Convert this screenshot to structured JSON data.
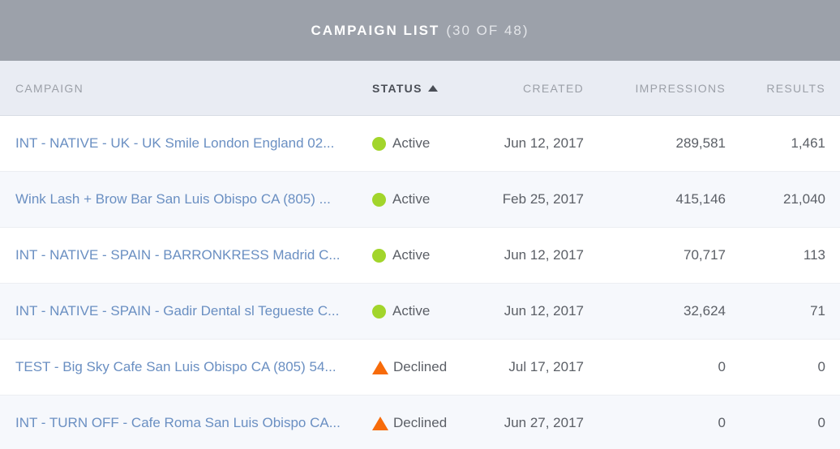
{
  "header": {
    "title": "CAMPAIGN LIST",
    "count": "(30 OF 48)"
  },
  "columns": {
    "campaign": "CAMPAIGN",
    "status": "STATUS",
    "created": "CREATED",
    "impressions": "IMPRESSIONS",
    "results": "RESULTS"
  },
  "sort": {
    "column": "STATUS",
    "direction": "ascending"
  },
  "colors": {
    "title_bar": "#9ca1aa",
    "link": "#6a8fc2",
    "active": "#a2d52b",
    "declined": "#f76b0a"
  },
  "rows": [
    {
      "campaign": "INT - NATIVE - UK - UK Smile London England 02...",
      "status": "Active",
      "status_icon": "active-dot-icon",
      "created": "Jun 12, 2017",
      "impressions": "289,581",
      "results": "1,461"
    },
    {
      "campaign": "Wink Lash + Brow Bar San Luis Obispo CA (805) ...",
      "status": "Active",
      "status_icon": "active-dot-icon",
      "created": "Feb 25, 2017",
      "impressions": "415,146",
      "results": "21,040"
    },
    {
      "campaign": "INT - NATIVE - SPAIN - BARRONKRESS Madrid C...",
      "status": "Active",
      "status_icon": "active-dot-icon",
      "created": "Jun 12, 2017",
      "impressions": "70,717",
      "results": "113"
    },
    {
      "campaign": "INT - NATIVE - SPAIN - Gadir Dental sl Tegueste C...",
      "status": "Active",
      "status_icon": "active-dot-icon",
      "created": "Jun 12, 2017",
      "impressions": "32,624",
      "results": "71"
    },
    {
      "campaign": "TEST - Big Sky Cafe San Luis Obispo CA (805) 54...",
      "status": "Declined",
      "status_icon": "warning-triangle-icon",
      "created": "Jul 17, 2017",
      "impressions": "0",
      "results": "0"
    },
    {
      "campaign": "INT - TURN OFF - Cafe Roma San Luis Obispo CA...",
      "status": "Declined",
      "status_icon": "warning-triangle-icon",
      "created": "Jun 27, 2017",
      "impressions": "0",
      "results": "0"
    }
  ]
}
